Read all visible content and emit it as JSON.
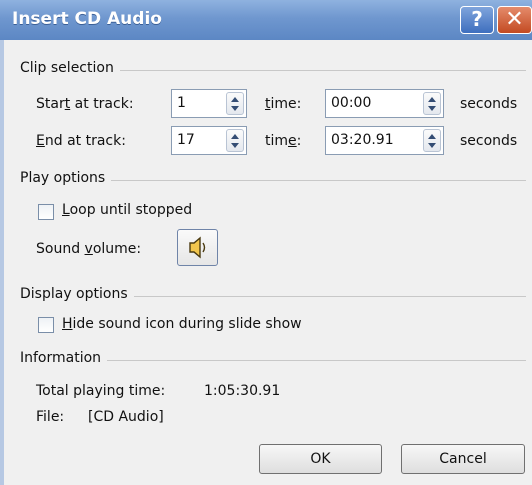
{
  "dialog": {
    "title": "Insert CD Audio",
    "help_glyph": "?",
    "close_glyph": "✕"
  },
  "clip_selection": {
    "header": "Clip selection",
    "start": {
      "label_pre": "Star",
      "label_key": "t",
      "label_post": " at track:",
      "track": "1",
      "time_pre": "",
      "time_key": "t",
      "time_post": "ime:",
      "time": "00:00",
      "unit": "seconds"
    },
    "end": {
      "label_pre": "",
      "label_key": "E",
      "label_post": "nd at track:",
      "track": "17",
      "time_pre": "tim",
      "time_key": "e",
      "time_post": ":",
      "time": "03:20.91",
      "unit": "seconds"
    }
  },
  "play_options": {
    "header": "Play options",
    "loop": {
      "key": "L",
      "rest": "oop until stopped",
      "checked": false
    },
    "volume": {
      "pre": "Sound ",
      "key": "v",
      "post": "olume:",
      "icon": "speaker-icon"
    }
  },
  "display_options": {
    "header": "Display options",
    "hide": {
      "key": "H",
      "rest": "ide sound icon during slide show",
      "checked": false
    }
  },
  "information": {
    "header": "Information",
    "total_label": "Total playing time:",
    "total_value": "1:05:30.91",
    "file_label": "File:",
    "file_value": "[CD Audio]"
  },
  "buttons": {
    "ok": "OK",
    "cancel": "Cancel"
  }
}
